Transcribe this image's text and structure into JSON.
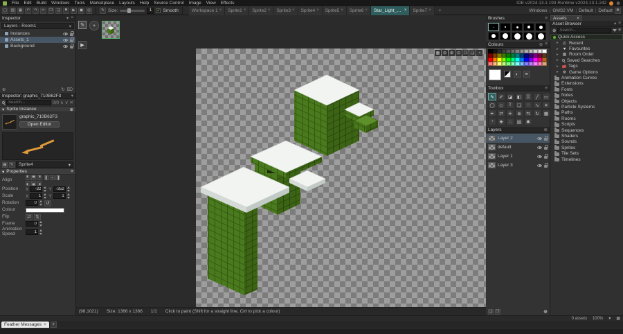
{
  "icons": {
    "chevron_down": "▾",
    "close": "×",
    "add": "⊕",
    "trash": "⌦",
    "refresh": "↻",
    "menu": "≡",
    "plus": "+",
    "check": "✓",
    "play": "▶",
    "pencil": "✎",
    "swap": "◐",
    "dropper": "✒",
    "grid": "▦",
    "prev": "∧",
    "next": "∨",
    "clear": "✕",
    "gear": "☸",
    "flip_h": "⇄",
    "flip_v": "⇅",
    "reset_rotation": "↺",
    "expand": "▸"
  },
  "menubar": {
    "items": [
      "File",
      "Edit",
      "Build",
      "Windows",
      "Tools",
      "Marketplace",
      "Layouts",
      "Help",
      "Source Control",
      "Image",
      "View",
      "Effects"
    ],
    "version_text": "IDE v2024.13.1.193   Runtime v2024.13.1.242"
  },
  "toolbar": {
    "icons": [
      {
        "name": "new-project-icon",
        "glyph": "▢"
      },
      {
        "name": "open-project-icon",
        "glyph": "▧"
      },
      {
        "name": "save-project-icon",
        "glyph": "▦"
      },
      {
        "name": "undo-icon",
        "glyph": "↶"
      },
      {
        "name": "redo-icon",
        "glyph": "↷"
      },
      {
        "name": "cut-icon",
        "glyph": "✂"
      },
      {
        "name": "copy-icon",
        "glyph": "❐"
      },
      {
        "name": "paste-icon",
        "glyph": "❏"
      },
      {
        "name": "debug-icon",
        "glyph": "⚑"
      },
      {
        "name": "run-icon",
        "glyph": "▶"
      },
      {
        "name": "stop-icon",
        "glyph": "◼"
      },
      {
        "name": "clean-icon",
        "glyph": "◎"
      }
    ],
    "brush_icon": "✎",
    "size_label": "Size:",
    "size_value": "1",
    "smooth_label": "Smooth",
    "tabs": [
      {
        "label": "Workspace 1",
        "active": false
      },
      {
        "label": "Sprite1",
        "active": false
      },
      {
        "label": "Sprite2",
        "active": false
      },
      {
        "label": "Sprite3",
        "active": false
      },
      {
        "label": "Sprite4",
        "active": false
      },
      {
        "label": "Sprite5",
        "active": false
      },
      {
        "label": "Sprite6",
        "active": false
      },
      {
        "label": "Star_Light_Asc...",
        "active": true
      },
      {
        "label": "Sprite7",
        "active": false
      }
    ],
    "target": [
      "Windows",
      "GMS2 VM",
      "Default",
      "Default"
    ]
  },
  "inspector": {
    "title": "Inspector",
    "layers_dropdown": "Layers - Room1",
    "tree": [
      {
        "label": "Instances",
        "selected": false
      },
      {
        "label": "Assets_1",
        "selected": true
      },
      {
        "label": "Background",
        "selected": false
      }
    ],
    "object_inspector_title": "Inspector: graphic_710B62F3",
    "search_placeholder": "Search...",
    "search_count": "0/0",
    "section_sprite_instance": "Sprite Instance",
    "sprite_name": "graphic_710B62F3",
    "open_editor_label": "Open Editor",
    "sprite_dropdown": "Sprite4",
    "section_properties": "Properties",
    "fields": {
      "align_label": "Align",
      "align_buttons": [
        {
          "name": "align-top-left-button",
          "glyph": "▘"
        },
        {
          "name": "align-top-button",
          "glyph": "▀"
        },
        {
          "name": "align-top-right-button",
          "glyph": "▝"
        },
        {
          "name": "align-left-button",
          "glyph": "▌"
        },
        {
          "name": "align-centre-button",
          "glyph": "▪"
        },
        {
          "name": "align-right-button",
          "glyph": "▐"
        },
        {
          "name": "align-bottom-left-button",
          "glyph": "▖"
        },
        {
          "name": "align-bottom-button",
          "glyph": "▄"
        },
        {
          "name": "align-bottom-right-button",
          "glyph": "▗"
        }
      ],
      "position_label": "Position",
      "pos_x_label": "X",
      "pos_x": "-32",
      "pos_y_label": "Y",
      "pos_y": "-352",
      "scale_label": "Scale",
      "scale_x_label": "X",
      "scale_x": "1",
      "scale_y_label": "Y",
      "scale_y": "1",
      "rotation_label": "Rotation",
      "rotation": "0",
      "colour_label": "Colour",
      "colour": "#ffffff",
      "flip_label": "Flip",
      "frame_label": "Frame",
      "frame": "0",
      "anim_speed_label": "Animation Speed",
      "anim_speed": "1"
    }
  },
  "canvas": {
    "frame_strip": {
      "edit": "✎",
      "add": "+",
      "play": "▶"
    },
    "zoom_buttons": [
      {
        "name": "toggle-grid-icon",
        "glyph": "▦"
      },
      {
        "name": "zoom-out-icon",
        "glyph": "⊖"
      },
      {
        "name": "zoom-in-icon",
        "glyph": "⊕"
      },
      {
        "name": "zoom-reset-icon",
        "glyph": "⊙"
      },
      {
        "name": "zoom-fit-icon",
        "glyph": "❐"
      },
      {
        "name": "fullscreen-icon",
        "glyph": "❑"
      },
      {
        "name": "onion-skin-icon",
        "glyph": "◔"
      }
    ],
    "status": {
      "coords": "(98,1021)",
      "size": "Size: 1366 x 1366",
      "frame": "1/1",
      "hint": "Click to paint (Shift for a straight line, Ctrl to pick a colour)"
    }
  },
  "brushes": {
    "title": "Brushes",
    "sizes": [
      1,
      2,
      3,
      4,
      5,
      6,
      8,
      10,
      12,
      14
    ]
  },
  "colours": {
    "title": "Colours",
    "primary": "#ffffff",
    "palette_rows": [
      [
        "#000000",
        "#151515",
        "#2b2b2b",
        "#404040",
        "#555555",
        "#6b6b6b",
        "#808080",
        "#959595",
        "#ababab",
        "#c0c0c0",
        "#d5d5d5",
        "#eaeaea",
        "#ffffff"
      ],
      [
        "#7f0000",
        "#7f3f00",
        "#7f7f00",
        "#3f7f00",
        "#007f00",
        "#007f3f",
        "#007f7f",
        "#003f7f",
        "#00007f",
        "#3f007f",
        "#7f007f",
        "#7f003f",
        "#5a3a1e"
      ],
      [
        "#ff0000",
        "#ff7f00",
        "#ffff00",
        "#7fff00",
        "#00ff00",
        "#00ff7f",
        "#00ffff",
        "#007fff",
        "#0000ff",
        "#7f00ff",
        "#ff00ff",
        "#ff007f",
        "#b5651d"
      ],
      [
        "#ff7f7f",
        "#ffbf7f",
        "#ffff7f",
        "#bfff7f",
        "#7fff7f",
        "#7fffbf",
        "#7fffff",
        "#7fbfff",
        "#7f7fff",
        "#bf7fff",
        "#ff7fff",
        "#ff7fbf",
        "#e0a878"
      ]
    ]
  },
  "toolbox": {
    "title": "Toolbox",
    "tools": [
      {
        "name": "pencil",
        "glyph": "✎",
        "selected": true
      },
      {
        "name": "brush",
        "glyph": "✐",
        "selected": false
      },
      {
        "name": "eraser",
        "glyph": "◪",
        "selected": false
      },
      {
        "name": "fill",
        "glyph": "◧",
        "selected": false
      },
      {
        "name": "spray",
        "glyph": "▒",
        "selected": false
      },
      {
        "name": "line",
        "glyph": "╱",
        "selected": false
      },
      {
        "name": "rectangle",
        "glyph": "▭",
        "selected": false
      },
      {
        "name": "ellipse",
        "glyph": "◯",
        "selected": false
      },
      {
        "name": "polygon",
        "glyph": "◇",
        "selected": false
      },
      {
        "name": "text",
        "glyph": "T",
        "selected": false
      },
      {
        "name": "select-rectangle",
        "glyph": "❏",
        "selected": false
      },
      {
        "name": "select-ellipse",
        "glyph": "◌",
        "selected": false
      },
      {
        "name": "select-lasso",
        "glyph": "∿",
        "selected": false
      },
      {
        "name": "magic-wand",
        "glyph": "✶",
        "selected": false
      },
      {
        "name": "eyedropper",
        "glyph": "✒",
        "selected": false
      },
      {
        "name": "replace-colour",
        "glyph": "⇄",
        "selected": false
      },
      {
        "name": "pan",
        "glyph": "✛",
        "selected": false
      },
      {
        "name": "zoom",
        "glyph": "⊕",
        "selected": false
      },
      {
        "name": "mirror",
        "glyph": "⇆",
        "selected": false
      },
      {
        "name": "rotate",
        "glyph": "↻",
        "selected": false
      },
      {
        "name": "grid",
        "glyph": "▦",
        "selected": false
      },
      {
        "name": "onion-skin",
        "glyph": "◔",
        "selected": false
      },
      {
        "name": "blur",
        "glyph": "❖",
        "selected": false
      },
      {
        "name": "noise",
        "glyph": "∴",
        "selected": false
      },
      {
        "name": "gradient",
        "glyph": "▧",
        "selected": false
      },
      {
        "name": "tool-settings",
        "glyph": "✱",
        "selected": false
      }
    ]
  },
  "layers_panel": {
    "title": "Layers",
    "layers": [
      {
        "name": "Layer 2",
        "selected": true
      },
      {
        "name": "default",
        "selected": false
      },
      {
        "name": "Layer 1",
        "selected": false
      },
      {
        "name": "Layer 3",
        "selected": false
      }
    ],
    "footer_icons": [
      {
        "name": "new-layer-icon",
        "glyph": "❏"
      },
      {
        "name": "new-layer-group-icon",
        "glyph": "❐"
      }
    ]
  },
  "asset_browser": {
    "tab_label": "Assets",
    "title": "Asset Browser",
    "search_placeholder": "Search...",
    "quick_access": {
      "label": "Quick Access",
      "children": [
        {
          "label": "Recent",
          "icon": "clock-icon"
        },
        {
          "label": "Favourites",
          "icon": "heart-icon"
        },
        {
          "label": "Room Order",
          "icon": "grid-icon"
        },
        {
          "label": "Saved Searches",
          "icon": "search-icon"
        },
        {
          "label": "Tags",
          "icon": "tag-icon"
        },
        {
          "label": "Game Options",
          "icon": "gear-icon"
        }
      ]
    },
    "groups": [
      "Animation Curves",
      "Extensions",
      "Fonts",
      "Notes",
      "Objects",
      "Particle Systems",
      "Paths",
      "Rooms",
      "Scripts",
      "Sequences",
      "Shaders",
      "Sounds",
      "Sprites",
      "Tile Sets",
      "Timelines"
    ],
    "footer": {
      "count": "0 assets",
      "zoom": "100%"
    }
  },
  "output": {
    "tab": "Feather Messages"
  }
}
